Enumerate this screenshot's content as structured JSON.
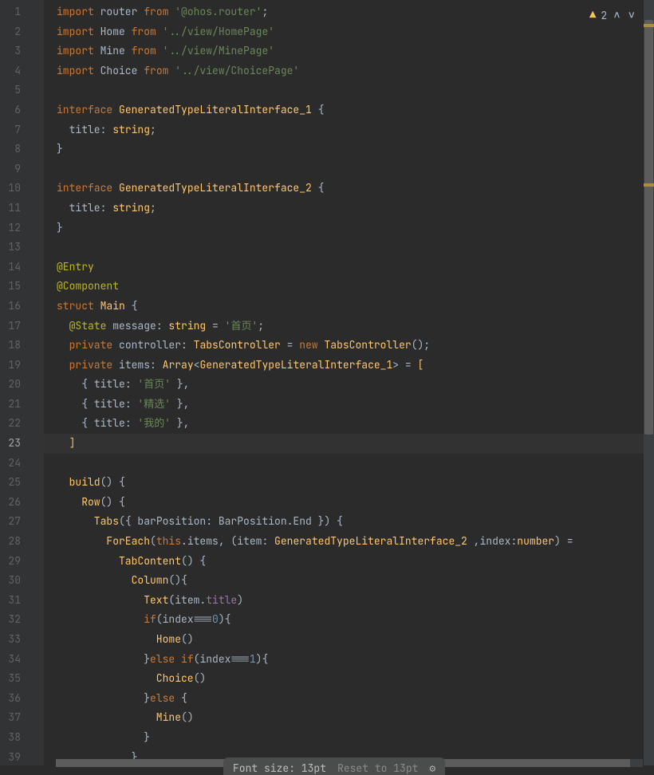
{
  "warnings": {
    "count": "2"
  },
  "status": {
    "fontsize": "Font size: 13pt",
    "reset": "Reset to 13pt"
  },
  "lines": [
    {
      "n": "1",
      "seg": [
        [
          "kw",
          "import "
        ],
        [
          "id",
          "router "
        ],
        [
          "kw",
          "from "
        ],
        [
          "str",
          "'@ohos.router'"
        ],
        [
          "pu",
          ";"
        ]
      ]
    },
    {
      "n": "2",
      "seg": [
        [
          "kw",
          "import "
        ],
        [
          "id",
          "Home "
        ],
        [
          "kw",
          "from "
        ],
        [
          "str",
          "'../view/HomePage'"
        ]
      ]
    },
    {
      "n": "3",
      "seg": [
        [
          "kw",
          "import "
        ],
        [
          "id",
          "Mine "
        ],
        [
          "kw",
          "from "
        ],
        [
          "str",
          "'../view/MinePage'"
        ]
      ]
    },
    {
      "n": "4",
      "seg": [
        [
          "kw",
          "import "
        ],
        [
          "id",
          "Choice "
        ],
        [
          "kw",
          "from "
        ],
        [
          "str",
          "'../view/ChoicePage'"
        ]
      ]
    },
    {
      "n": "5",
      "seg": []
    },
    {
      "n": "6",
      "seg": [
        [
          "kw",
          "interface "
        ],
        [
          "type",
          "GeneratedTypeLiteralInterface_1 "
        ],
        [
          "pu",
          "{"
        ]
      ]
    },
    {
      "n": "7",
      "seg": [
        [
          "id",
          "  title"
        ],
        [
          "pu",
          ": "
        ],
        [
          "type",
          "string"
        ],
        [
          "pu",
          ";"
        ]
      ]
    },
    {
      "n": "8",
      "seg": [
        [
          "pu",
          "}"
        ]
      ]
    },
    {
      "n": "9",
      "seg": []
    },
    {
      "n": "10",
      "seg": [
        [
          "kw",
          "interface "
        ],
        [
          "type",
          "GeneratedTypeLiteralInterface_2 "
        ],
        [
          "pu",
          "{"
        ]
      ]
    },
    {
      "n": "11",
      "seg": [
        [
          "id",
          "  title"
        ],
        [
          "pu",
          ": "
        ],
        [
          "type",
          "string"
        ],
        [
          "pu",
          ";"
        ]
      ]
    },
    {
      "n": "12",
      "seg": [
        [
          "pu",
          "}"
        ]
      ]
    },
    {
      "n": "13",
      "seg": []
    },
    {
      "n": "14",
      "seg": [
        [
          "dec",
          "@Entry"
        ]
      ]
    },
    {
      "n": "15",
      "seg": [
        [
          "dec",
          "@Component"
        ]
      ]
    },
    {
      "n": "16",
      "seg": [
        [
          "kw",
          "struct "
        ],
        [
          "type",
          "Main "
        ],
        [
          "pu",
          "{"
        ]
      ]
    },
    {
      "n": "17",
      "seg": [
        [
          "dec",
          "  @State "
        ],
        [
          "id",
          "message"
        ],
        [
          "pu",
          ": "
        ],
        [
          "type",
          "string "
        ],
        [
          "pu",
          "= "
        ],
        [
          "str",
          "'首页'"
        ],
        [
          "pu",
          ";"
        ]
      ]
    },
    {
      "n": "18",
      "seg": [
        [
          "kw",
          "  private "
        ],
        [
          "id",
          "controller"
        ],
        [
          "pu",
          ": "
        ],
        [
          "type",
          "TabsController "
        ],
        [
          "pu",
          "= "
        ],
        [
          "kw",
          "new "
        ],
        [
          "type",
          "TabsController"
        ],
        [
          "pu",
          "();"
        ]
      ]
    },
    {
      "n": "19",
      "seg": [
        [
          "kw",
          "  private "
        ],
        [
          "id",
          "items"
        ],
        [
          "pu",
          ": "
        ],
        [
          "type",
          "Array"
        ],
        [
          "pu",
          "<"
        ],
        [
          "type",
          "GeneratedTypeLiteralInterface_1"
        ],
        [
          "pu",
          "> = "
        ],
        [
          "br1",
          "["
        ]
      ]
    },
    {
      "n": "20",
      "seg": [
        [
          "pu",
          "    { "
        ],
        [
          "id",
          "title"
        ],
        [
          "pu",
          ": "
        ],
        [
          "str",
          "'首页'"
        ],
        [
          "pu",
          " },"
        ]
      ]
    },
    {
      "n": "21",
      "seg": [
        [
          "pu",
          "    { "
        ],
        [
          "id",
          "title"
        ],
        [
          "pu",
          ": "
        ],
        [
          "str",
          "'精选'"
        ],
        [
          "pu",
          " },"
        ]
      ]
    },
    {
      "n": "22",
      "seg": [
        [
          "pu",
          "    { "
        ],
        [
          "id",
          "title"
        ],
        [
          "pu",
          ": "
        ],
        [
          "str",
          "'我的'"
        ],
        [
          "pu",
          " },"
        ]
      ]
    },
    {
      "n": "23",
      "hl": true,
      "seg": [
        [
          "br1",
          "  ]"
        ]
      ]
    },
    {
      "n": "24",
      "seg": []
    },
    {
      "n": "25",
      "seg": [
        [
          "fn",
          "  build"
        ],
        [
          "pu",
          "() {"
        ]
      ]
    },
    {
      "n": "26",
      "seg": [
        [
          "fn",
          "    Row"
        ],
        [
          "pu",
          "() {"
        ]
      ]
    },
    {
      "n": "27",
      "seg": [
        [
          "fn",
          "      Tabs"
        ],
        [
          "pu",
          "({ "
        ],
        [
          "id",
          "barPosition"
        ],
        [
          "pu",
          ": BarPosition.End }"
        ],
        [
          "pu",
          ") {"
        ]
      ]
    },
    {
      "n": "28",
      "seg": [
        [
          "fn",
          "        ForEach"
        ],
        [
          "pu",
          "("
        ],
        [
          "kw",
          "this"
        ],
        [
          "pu",
          ".items, ("
        ],
        [
          "id",
          "item"
        ],
        [
          "pu",
          ": "
        ],
        [
          "type",
          "GeneratedTypeLiteralInterface_2 "
        ],
        [
          "pu",
          ","
        ],
        [
          "id",
          "index"
        ],
        [
          "pu",
          ":"
        ],
        [
          "type",
          "number"
        ],
        [
          "pu",
          ") ="
        ]
      ]
    },
    {
      "n": "29",
      "seg": [
        [
          "fn",
          "          TabContent"
        ],
        [
          "pu",
          "() {"
        ]
      ]
    },
    {
      "n": "30",
      "seg": [
        [
          "fn",
          "            Column"
        ],
        [
          "pu",
          "(){"
        ]
      ]
    },
    {
      "n": "31",
      "seg": [
        [
          "fn",
          "              Text"
        ],
        [
          "pu",
          "("
        ],
        [
          "id",
          "item"
        ],
        [
          "pu",
          "."
        ],
        [
          "field",
          "title"
        ],
        [
          "pu",
          ")"
        ]
      ]
    },
    {
      "n": "32",
      "seg": [
        [
          "kw",
          "              if"
        ],
        [
          "pu",
          "("
        ],
        [
          "id",
          "index"
        ],
        [
          "pu",
          "==="
        ],
        [
          "num",
          "0"
        ],
        [
          "pu",
          "){"
        ]
      ]
    },
    {
      "n": "33",
      "seg": [
        [
          "fn",
          "                Home"
        ],
        [
          "pu",
          "()"
        ]
      ]
    },
    {
      "n": "34",
      "seg": [
        [
          "pu",
          "              }"
        ],
        [
          "kw",
          "else if"
        ],
        [
          "pu",
          "("
        ],
        [
          "id",
          "index"
        ],
        [
          "pu",
          "==="
        ],
        [
          "num",
          "1"
        ],
        [
          "pu",
          "){"
        ]
      ]
    },
    {
      "n": "35",
      "seg": [
        [
          "fn",
          "                Choice"
        ],
        [
          "pu",
          "()"
        ]
      ]
    },
    {
      "n": "36",
      "seg": [
        [
          "pu",
          "              }"
        ],
        [
          "kw",
          "else "
        ],
        [
          "pu",
          "{"
        ]
      ]
    },
    {
      "n": "37",
      "seg": [
        [
          "fn",
          "                Mine"
        ],
        [
          "pu",
          "()"
        ]
      ]
    },
    {
      "n": "38",
      "seg": [
        [
          "pu",
          "              }"
        ]
      ]
    },
    {
      "n": "39",
      "seg": [
        [
          "pu",
          "            }"
        ]
      ]
    }
  ]
}
